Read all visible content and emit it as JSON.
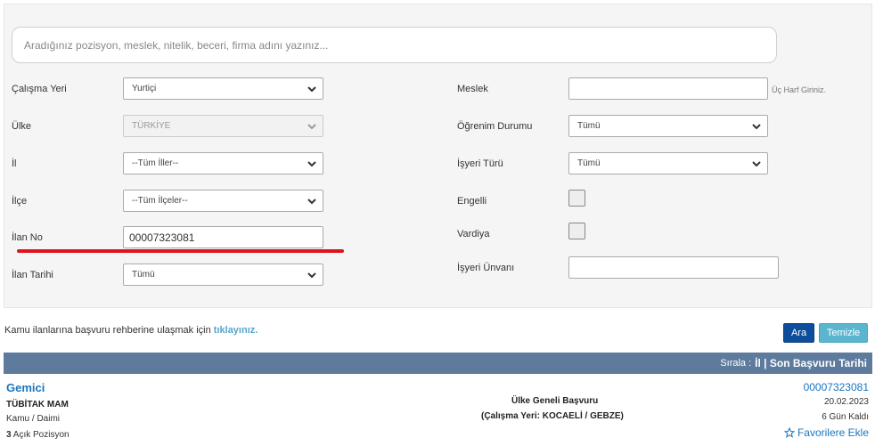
{
  "search": {
    "placeholder": "Aradığınız pozisyon, meslek, nitelik, beceri, firma adını yazınız..."
  },
  "form": {
    "calisma_yeri": {
      "label": "Çalışma Yeri",
      "value": "Yurtiçi"
    },
    "ulke": {
      "label": "Ülke",
      "value": "TÜRKİYE"
    },
    "il": {
      "label": "İl",
      "value": "--Tüm İller--"
    },
    "ilce": {
      "label": "İlçe",
      "value": "--Tüm İlçeler--"
    },
    "ilan_no": {
      "label": "İlan No",
      "value": "00007323081"
    },
    "ilan_tarihi": {
      "label": "İlan Tarihi",
      "value": "Tümü"
    },
    "meslek": {
      "label": "Meslek",
      "value": "",
      "hint": "Üç Harf Giriniz."
    },
    "ogrenim": {
      "label": "Öğrenim Durumu",
      "value": "Tümü"
    },
    "isyeri_turu": {
      "label": "İşyeri Türü",
      "value": "Tümü"
    },
    "engelli": {
      "label": "Engelli",
      "checked": false
    },
    "vardiya": {
      "label": "Vardiya",
      "checked": false
    },
    "isyeri_unvani": {
      "label": "İşyeri Ünvanı",
      "value": ""
    }
  },
  "note": {
    "text": "Kamu ilanlarına başvuru rehberine ulaşmak için ",
    "link": "tıklayınız."
  },
  "buttons": {
    "search": "Ara",
    "clear": "Temizle"
  },
  "sort": {
    "prefix": "Sırala :",
    "options": "İl | Son Başvuru Tarihi"
  },
  "result": {
    "title": "Gemici",
    "company": "TÜBİTAK MAM",
    "type": "Kamu / Daimi",
    "positions_count": "3",
    "positions_label": " Açık Pozisyon",
    "application_scope": "Ülke Geneli Başvuru",
    "location": "(Çalışma Yeri: KOCAELİ / GEBZE)",
    "ilan_no": "00007323081",
    "date": "20.02.2023",
    "days_left": "6 Gün Kaldı",
    "favorite": "Favorilere Ekle"
  },
  "colors": {
    "accent_red": "#e0141e",
    "sort_bar": "#5e7b9e",
    "link_blue": "#1b75bc",
    "search_button": "#0d4e9c",
    "clear_button": "#5ab6cf"
  }
}
